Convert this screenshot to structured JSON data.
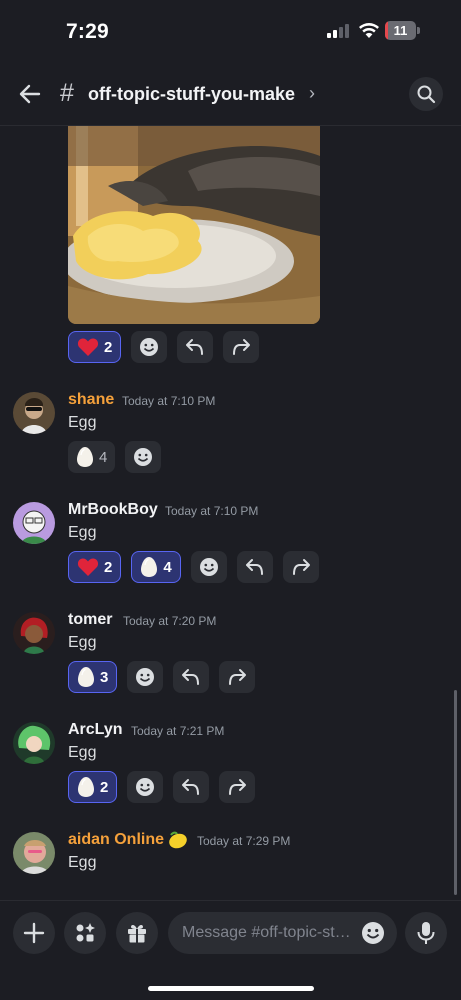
{
  "status_bar": {
    "time": "7:29",
    "battery": "11",
    "battery_level": 0.11
  },
  "header": {
    "hash": "#",
    "channel": "off-topic-stuff-you-make",
    "chevron": "›"
  },
  "top_reactions": [
    {
      "emoji": "heart",
      "count": "2",
      "me": true
    }
  ],
  "messages": [
    {
      "author": "shane",
      "author_color": "#f5a13b",
      "time": "Today at 7:10 PM",
      "text": "Egg",
      "reactions": [
        {
          "emoji": "egg",
          "count": "4",
          "me": false
        }
      ]
    },
    {
      "author": "MrBookBoy",
      "author_color": "#f2f3f5",
      "time": "Today at 7:10 PM",
      "text": "Egg",
      "reactions": [
        {
          "emoji": "heart",
          "count": "2",
          "me": true
        },
        {
          "emoji": "egg",
          "count": "4",
          "me": true
        }
      ]
    },
    {
      "author": "tomer",
      "author_color": "#f2f3f5",
      "time": "Today at 7:20 PM",
      "text": "Egg",
      "reactions": [
        {
          "emoji": "egg",
          "count": "3",
          "me": true
        }
      ]
    },
    {
      "author": "ArcLyn",
      "author_color": "#f2f3f5",
      "time": "Today at 7:21 PM",
      "text": "Egg",
      "reactions": [
        {
          "emoji": "egg",
          "count": "2",
          "me": true
        }
      ]
    },
    {
      "author": "aidan Online",
      "author_color": "#f5a13b",
      "time": "Today at 7:29 PM",
      "text": "Egg",
      "badge": "lemon-icon"
    }
  ],
  "composer": {
    "placeholder": "Message #off-topic-st…"
  },
  "colors": {
    "accent": "#5865f2",
    "background": "#1c1d23",
    "surface": "#2b2d33",
    "orange": "#f5a13b"
  }
}
